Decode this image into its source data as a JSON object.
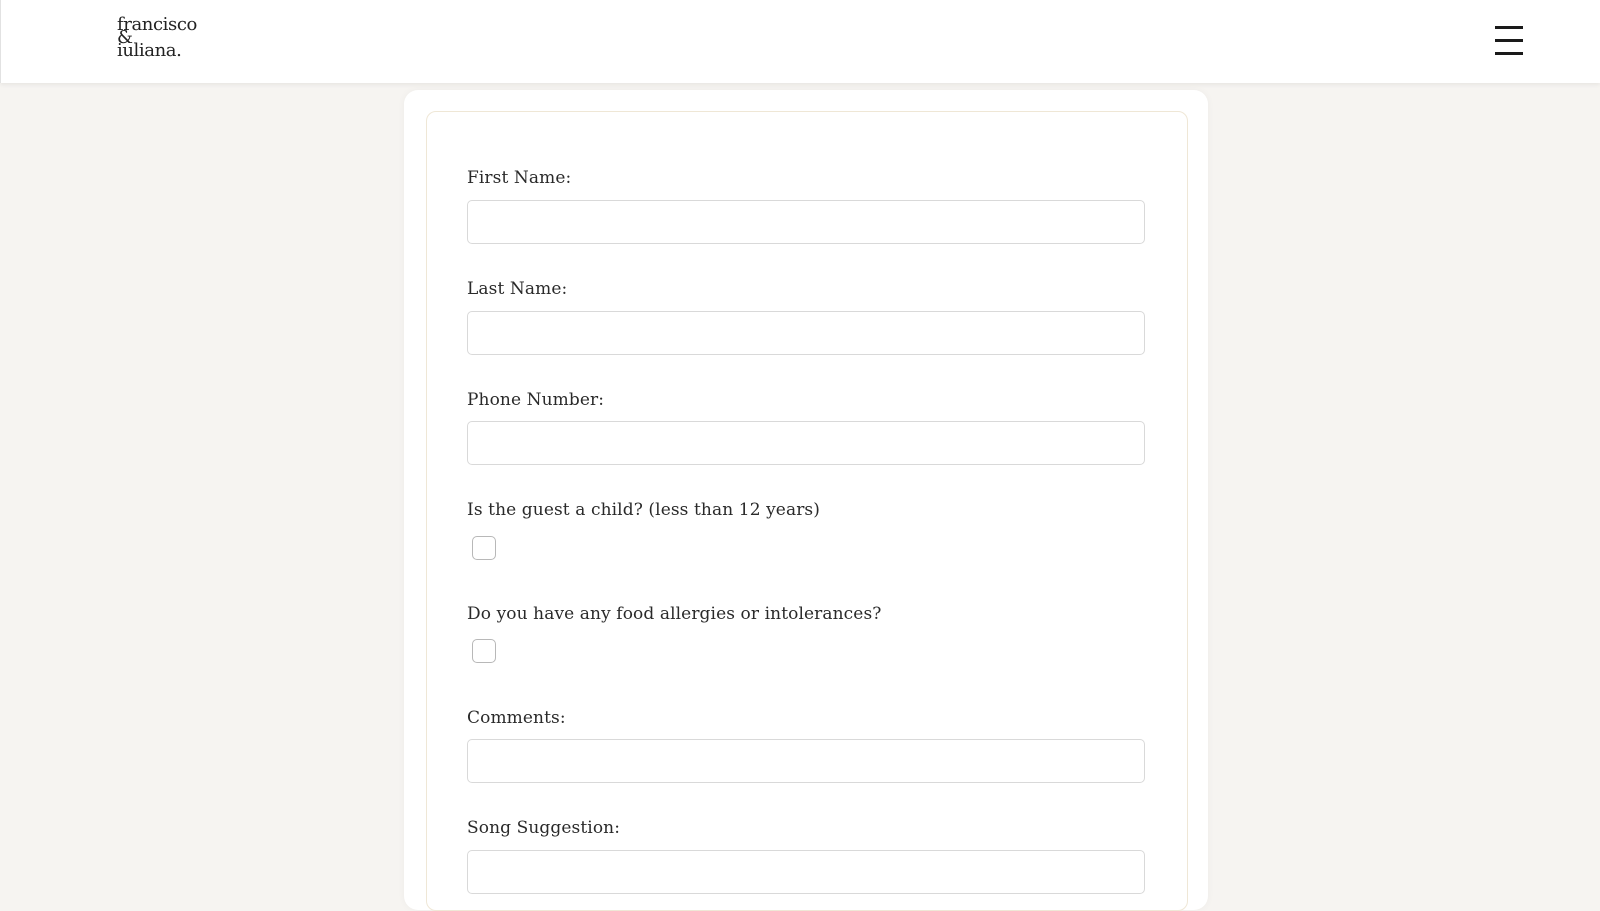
{
  "header": {
    "logo_line1": "francisco",
    "logo_line2": "&",
    "logo_line3": "iuliana.",
    "menu_icon": "hamburger-menu-icon"
  },
  "form": {
    "first_name": {
      "label": "First Name:",
      "value": "",
      "placeholder": ""
    },
    "last_name": {
      "label": "Last Name:",
      "value": "",
      "placeholder": ""
    },
    "phone": {
      "label": "Phone Number:",
      "value": "",
      "placeholder": ""
    },
    "is_child": {
      "label": "Is the guest a child? (less than 12 years)",
      "checked": false
    },
    "allergies": {
      "label": "Do you have any food allergies or intolerances?",
      "checked": false
    },
    "comments": {
      "label": "Comments:",
      "value": "",
      "placeholder": ""
    },
    "song": {
      "label": "Song Suggestion:",
      "value": "",
      "placeholder": ""
    }
  },
  "colors": {
    "page_background": "#f6f4f1",
    "card_border": "#efe7d6",
    "text": "#2a2a2a"
  }
}
